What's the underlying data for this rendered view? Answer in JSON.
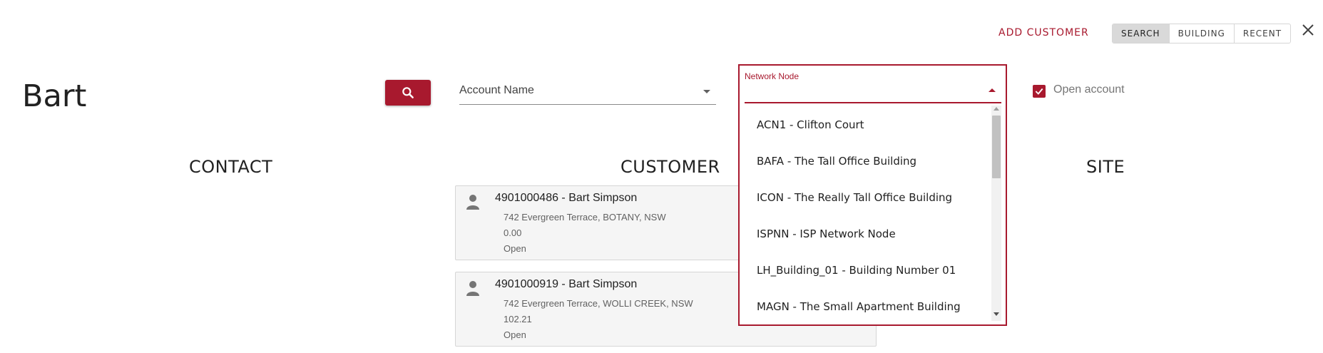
{
  "header": {
    "add_customer": "ADD CUSTOMER",
    "modes": [
      "SEARCH",
      "BUILDING",
      "RECENT"
    ],
    "active_mode": "SEARCH",
    "close_icon": "close-icon"
  },
  "search": {
    "query": "Bart",
    "button_icon": "search-icon",
    "account_field_label": "Account Name",
    "network_node_label": "Network Node",
    "open_account_label": "Open account",
    "open_account_checked": true
  },
  "network_node_options": [
    "ACN1 - Clifton Court",
    "BAFA - The Tall Office Building",
    "ICON - The Really Tall Office Building",
    "ISPNN - ISP Network Node",
    "LH_Building_01 - Building Number 01",
    "MAGN - The Small Apartment Building"
  ],
  "columns": {
    "contact": "CONTACT",
    "customer": "CUSTOMER",
    "site": "SITE"
  },
  "customers": [
    {
      "title": "4901000486 - Bart Simpson",
      "address": "742 Evergreen Terrace, BOTANY, NSW",
      "balance": "0.00",
      "status": "Open"
    },
    {
      "title": "4901000919 - Bart Simpson",
      "address": "742 Evergreen Terrace, WOLLI CREEK, NSW",
      "balance": "102.21",
      "status": "Open"
    }
  ],
  "colors": {
    "accent": "#a8192e",
    "card_bg": "#f5f5f5",
    "toggle_active": "#d9d9d9"
  }
}
